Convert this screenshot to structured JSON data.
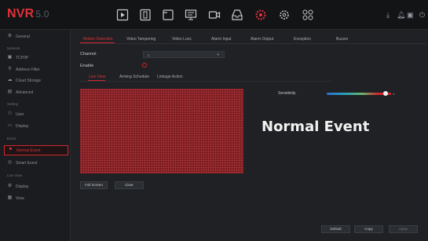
{
  "app": {
    "logo": "NVR",
    "version": "5.0"
  },
  "topbar": {
    "icons": [
      "playback-icon",
      "media-icon",
      "file-icon",
      "monitor-icon",
      "camera-icon",
      "storage-icon",
      "settings-icon",
      "network-settings-icon",
      "grid-icon"
    ],
    "right_icons": [
      "download-icon",
      "alarm-bell-icon",
      "user-icon",
      "power-icon"
    ]
  },
  "sidebar": {
    "general": "General",
    "network_head": "Network",
    "items": [
      {
        "label": "TCP/IP",
        "icon": "tcpip-icon"
      },
      {
        "label": "Address Filter",
        "icon": "location-icon"
      },
      {
        "label": "Cloud Storage",
        "icon": "cloud-icon"
      },
      {
        "label": "Advanced",
        "icon": "advanced-icon"
      }
    ],
    "setting_head": "Setting",
    "setting_items": [
      {
        "label": "User",
        "icon": "user-icon"
      },
      {
        "label": "Display",
        "icon": "display-icon"
      }
    ],
    "event_head": "Event",
    "event_items": [
      {
        "label": "Normal Event",
        "icon": "normal-event-icon",
        "active": true
      },
      {
        "label": "Smart Event",
        "icon": "smart-event-icon"
      }
    ],
    "live_head": "Live View",
    "live_items": [
      {
        "label": "Display",
        "icon": "display-icon"
      },
      {
        "label": "View",
        "icon": "view-icon"
      }
    ]
  },
  "tabs": [
    "Motion Detection",
    "Video Tampering",
    "Video Loss",
    "Alarm Input",
    "Alarm Output",
    "Exception",
    "Buzzer"
  ],
  "form": {
    "channel_label": "Channel",
    "channel_value": "1",
    "enable_label": "Enable"
  },
  "subtabs": [
    "Live View",
    "Arming Schedule",
    "Linkage Action"
  ],
  "sensitivity": {
    "label": "Sensitivity",
    "value": "4",
    "level": 0.95
  },
  "overlay": "Normal Event",
  "buttons": {
    "full_screen": "Full Screen",
    "clear": "Clear",
    "default": "Default",
    "copy": "Copy",
    "apply": "Apply"
  },
  "colors": {
    "accent": "#d3252e",
    "grid": "#7a1a1f",
    "background": "#1f2124"
  }
}
